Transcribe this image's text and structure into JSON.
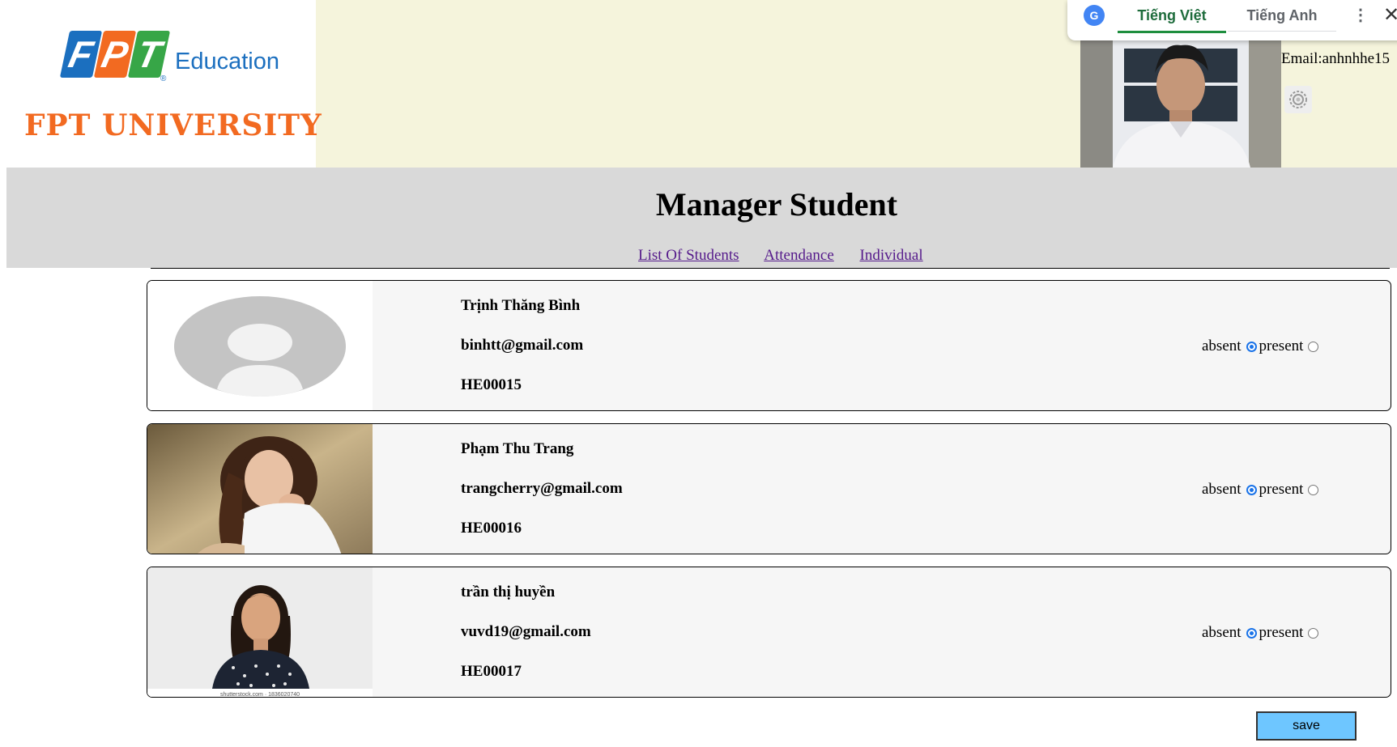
{
  "header": {
    "brand": {
      "letters": [
        "F",
        "P",
        "T"
      ],
      "education": "Education",
      "registered": "®",
      "university": "FPT UNIVERSITY"
    },
    "email_label": "Email:anhnhhe15",
    "settings_icon": "gear-icon"
  },
  "translate_bar": {
    "logo_text": "G",
    "tab_vi": "Tiếng Việt",
    "tab_en": "Tiếng Anh",
    "more": "⋮",
    "close": "✕"
  },
  "page": {
    "title": "Manager Student",
    "nav": [
      "List Of Students",
      "Attendance",
      "Individual"
    ]
  },
  "students": [
    {
      "name": "Trịnh Thăng Bình",
      "email": "binhtt@gmail.com",
      "code": "HE00015",
      "absent_label": "absent",
      "present_label": "present",
      "selected": "absent"
    },
    {
      "name": "Phạm Thu Trang",
      "email": "trangcherry@gmail.com",
      "code": "HE00016",
      "absent_label": "absent",
      "present_label": "present",
      "selected": "absent"
    },
    {
      "name": "trần thị huyền",
      "email": "vuvd19@gmail.com",
      "code": "HE00017",
      "absent_label": "absent",
      "present_label": "present",
      "selected": "absent"
    }
  ],
  "photo3_caption": "shutterstock.com · 1836020740",
  "save_label": "save",
  "colors": {
    "header_bg": "#f5f4dc",
    "banner_bg": "#d9d9d9",
    "save_bg": "#6ec6ff",
    "link": "#551a8b",
    "radio_accent": "#1a73e8"
  }
}
